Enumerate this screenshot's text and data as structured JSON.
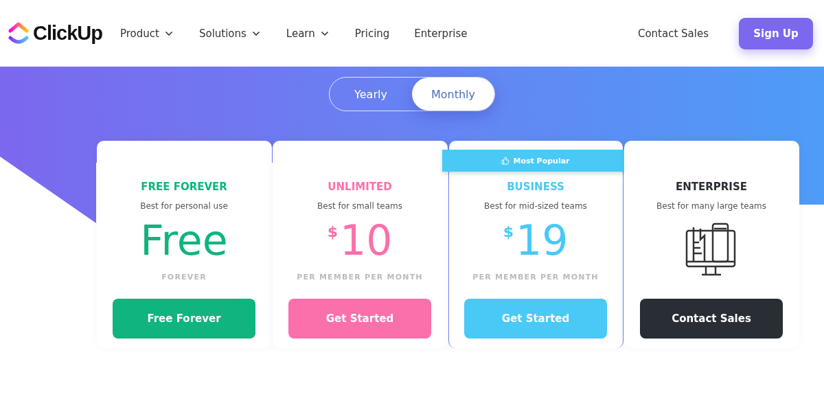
{
  "brand": "ClickUp",
  "nav": [
    {
      "label": "Product",
      "dropdown": true
    },
    {
      "label": "Solutions",
      "dropdown": true
    },
    {
      "label": "Learn",
      "dropdown": true
    },
    {
      "label": "Pricing",
      "dropdown": false
    },
    {
      "label": "Enterprise",
      "dropdown": false
    }
  ],
  "contact_link": "Contact Sales",
  "signup_button": "Sign Up",
  "billing_toggle": [
    {
      "label": "Yearly",
      "selected": false
    },
    {
      "label": "Monthly",
      "selected": true
    }
  ],
  "plans": [
    {
      "kind": "price",
      "name": "FREE FOREVER",
      "subtitle": "Best for personal use",
      "amount": "Free",
      "period": "FOREVER",
      "button": "Free Forever",
      "color": "#0fb47f",
      "button_dark": false
    },
    {
      "kind": "price",
      "name": "UNLIMITED",
      "subtitle": "Best for small teams",
      "currency": "$",
      "amount": "10",
      "period": "PER MEMBER PER MONTH",
      "button": "Get Started",
      "color": "#fb6fab",
      "button_dark": false
    },
    {
      "kind": "price",
      "name": "BUSINESS",
      "subtitle": "Best for mid-sized teams",
      "currency": "$",
      "amount": "19",
      "period": "PER MEMBER PER MONTH",
      "button": "Get Started",
      "color": "#49c9f5",
      "badge": "Most Popular",
      "button_dark": false
    },
    {
      "kind": "illustration",
      "name": "ENTERPRISE",
      "subtitle": "Best for many large teams",
      "button": "Contact Sales",
      "color": "#292d34",
      "button_dark": true
    }
  ]
}
